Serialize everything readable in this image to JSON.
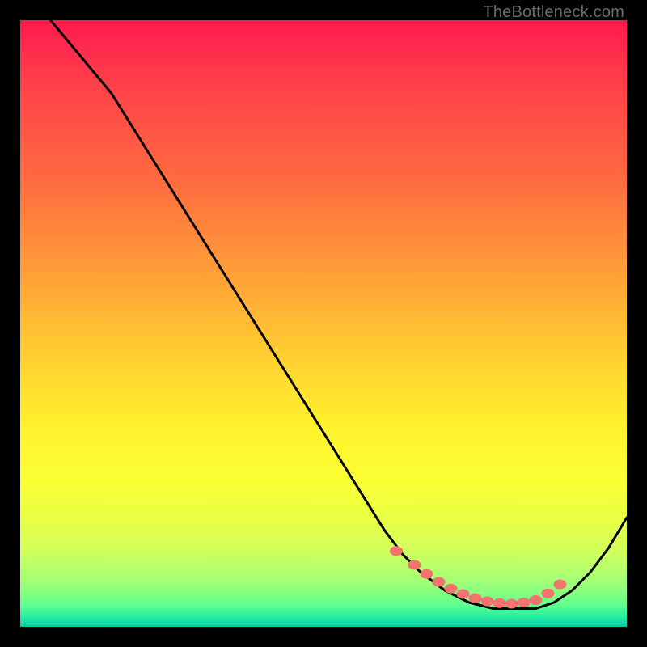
{
  "watermark": "TheBottleneck.com",
  "chart_data": {
    "type": "line",
    "title": "",
    "xlabel": "",
    "ylabel": "",
    "xlim": [
      0,
      100
    ],
    "ylim": [
      0,
      100
    ],
    "grid": false,
    "series": [
      {
        "name": "curve",
        "color": "#000000",
        "x": [
          5,
          10,
          15,
          20,
          25,
          30,
          35,
          40,
          45,
          50,
          55,
          60,
          63,
          66,
          70,
          74,
          78,
          82,
          85,
          88,
          91,
          94,
          97,
          100
        ],
        "y": [
          100,
          94,
          88,
          80,
          72,
          64,
          56,
          48,
          40,
          32,
          24,
          16,
          12,
          9,
          6,
          4,
          3,
          3,
          3,
          4,
          6,
          9,
          13,
          18
        ]
      }
    ],
    "dots": {
      "color": "#f4736f",
      "x": [
        62,
        65,
        67,
        69,
        71,
        73,
        75,
        77,
        79,
        81,
        83,
        85,
        87,
        89
      ],
      "y": [
        12.5,
        10.2,
        8.7,
        7.4,
        6.3,
        5.4,
        4.7,
        4.2,
        3.9,
        3.8,
        4.0,
        4.4,
        5.5,
        7.0
      ]
    }
  }
}
